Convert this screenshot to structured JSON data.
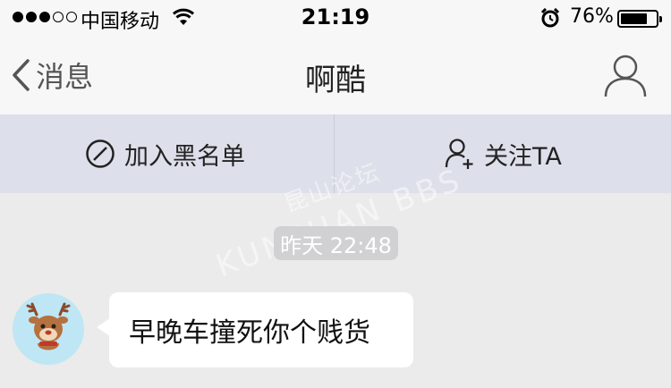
{
  "status_bar": {
    "carrier": "中国移动",
    "time": "21:19",
    "battery_percent": "76%",
    "battery_level": 0.76,
    "signal_bars_filled": 3,
    "signal_bars_total": 5
  },
  "nav": {
    "back_label": "消息",
    "title": "啊酷",
    "profile_icon": "person-icon"
  },
  "actions": {
    "blacklist_label": "加入黑名单",
    "follow_label": "关注TA"
  },
  "watermark": {
    "cn": "昆山论坛",
    "en": "KUNSHAN BBS"
  },
  "chat": {
    "timestamp": "昨天 22:48",
    "messages": [
      {
        "sender": "other",
        "text": "早晚车撞死你个贱货"
      }
    ]
  },
  "colors": {
    "status_bg": "#f7f7f8",
    "action_bar_bg": "#dde0ea",
    "chat_bg": "#ebebeb",
    "timestamp_bg": "#d1d1d3",
    "bubble_bg": "#ffffff"
  }
}
